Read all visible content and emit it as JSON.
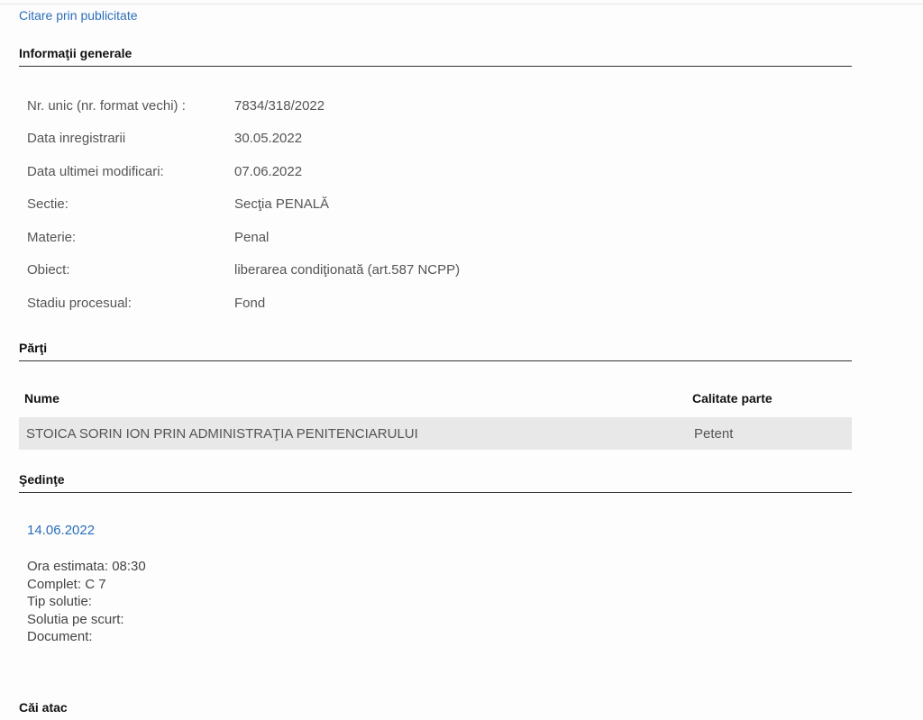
{
  "top_link": "Citare prin publicitate",
  "sections": {
    "general": "Informaţii generale",
    "parti": "Părţi",
    "sedinte": "Şedinţe",
    "cai_atac": "Căi atac"
  },
  "general_info": [
    {
      "label": "Nr. unic (nr. format vechi) :",
      "value": "7834/318/2022"
    },
    {
      "label": "Data inregistrarii",
      "value": "30.05.2022"
    },
    {
      "label": "Data ultimei modificari:",
      "value": "07.06.2022"
    },
    {
      "label": "Sectie:",
      "value": "Secţia PENALĂ"
    },
    {
      "label": "Materie:",
      "value": "Penal"
    },
    {
      "label": "Obiect:",
      "value": "liberarea condiţionată (art.587 NCPP)"
    },
    {
      "label": "Stadiu procesual:",
      "value": "Fond"
    }
  ],
  "parti_table": {
    "headers": [
      "Nume",
      "Calitate parte"
    ],
    "rows": [
      [
        "STOICA SORIN ION PRIN ADMINISTRAŢIA PENITENCIARULUI",
        "Petent"
      ]
    ]
  },
  "sedinte": {
    "date": "14.06.2022",
    "lines": [
      "Ora estimata: 08:30",
      "Complet: C 7",
      "Tip solutie:",
      "Solutia pe scurt:",
      "Document:"
    ]
  }
}
